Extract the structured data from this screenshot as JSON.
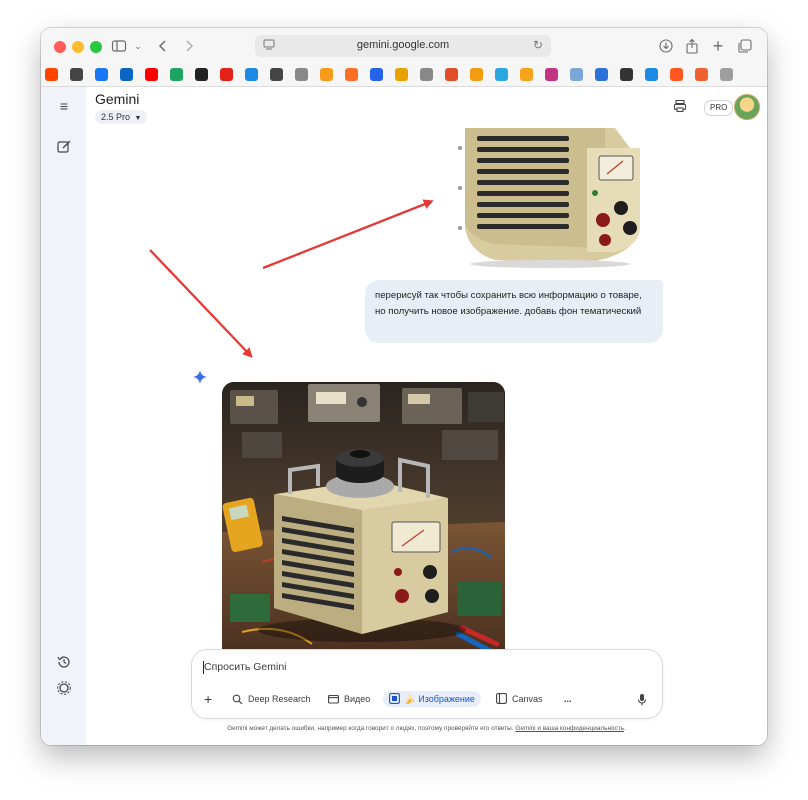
{
  "browser": {
    "url": "gemini.google.com",
    "controls": [
      "sidebar-toggle",
      "back",
      "forward"
    ],
    "right_icons": [
      "download-icon",
      "share-icon",
      "new-tab-icon",
      "tabs-icon"
    ]
  },
  "bookmarks": {
    "colors": [
      "#ff4500",
      "#444444",
      "#1877f2",
      "#0a66c2",
      "#ff0000",
      "#1da462",
      "#222222",
      "#e62117",
      "#1e88e5",
      "#444444",
      "#888888",
      "#f79b1a",
      "#fc6d26",
      "#2563eb",
      "#e8a200",
      "#888888",
      "#e14c2b",
      "#f39c12",
      "#2aa7e0",
      "#f6a21b",
      "#c13584",
      "#7aa7d6",
      "#2d72d9",
      "#333333",
      "#1e88e5",
      "#ff5722",
      "#f06030",
      "#9e9e9e"
    ]
  },
  "sidebar": {
    "menu_icon": "menu-icon",
    "new_chat_icon": "edit-icon",
    "activity_icon": "history-icon",
    "settings_icon": "settings-icon"
  },
  "header": {
    "title": "Gemini",
    "model": "2.5 Pro",
    "pro_label": "PRO"
  },
  "chat": {
    "user_message": "перерисуй так чтобы сохранить всю информацию о товаре, но получить новое изображение. добавь фон тематический"
  },
  "input": {
    "placeholder": "Спросить Gemini",
    "tools": {
      "deep_research": "Deep Research",
      "video": "Видео",
      "image": "Изображение",
      "canvas": "Canvas",
      "more": "..."
    }
  },
  "footer": {
    "note": "Gemini может делать ошибки, например когда говорит о людях, поэтому проверяйте его ответы.",
    "link": "Gemini и ваша конфиденциальность"
  },
  "colors": {
    "arrow": "#e53935",
    "spark": "#3b6fe0",
    "sidebar_bg": "#f0f4f9",
    "bubble_bg": "#e9eef6"
  }
}
